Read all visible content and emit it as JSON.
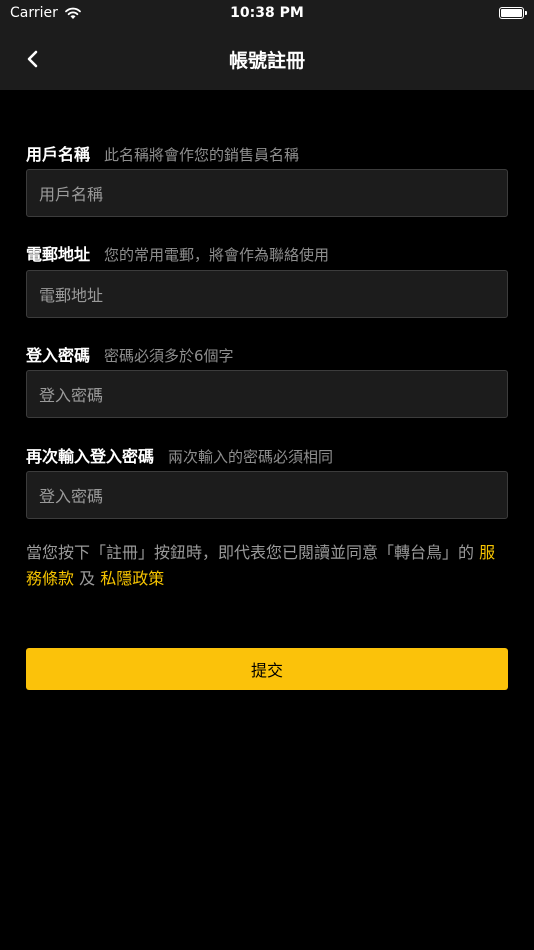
{
  "status_bar": {
    "carrier": "Carrier",
    "time": "10:38 PM",
    "battery_level": 1.0
  },
  "nav": {
    "title": "帳號註冊",
    "back_icon": "chevron-left-icon"
  },
  "fields": {
    "username": {
      "label": "用戶名稱",
      "hint": "此名稱將會作您的銷售員名稱",
      "placeholder": "用戶名稱"
    },
    "email": {
      "label": "電郵地址",
      "hint": "您的常用電郵，將會作為聯絡使用",
      "placeholder": "電郵地址"
    },
    "password": {
      "label": "登入密碼",
      "hint": "密碼必須多於6個字",
      "placeholder": "登入密碼"
    },
    "confirm_password": {
      "label": "再次輸入登入密碼",
      "hint": "兩次輸入的密碼必須相同",
      "placeholder": "登入密碼"
    }
  },
  "agreement": {
    "text_before": "當您按下「註冊」按鈕時，即代表您已閱讀並同意「轉台鳥」的 ",
    "terms_link": "服務條款",
    "conjunction": " 及 ",
    "privacy_link": "私隱政策"
  },
  "submit": {
    "label": "提交"
  },
  "colors": {
    "accent": "#fbc20a",
    "link": "#f6c400",
    "background": "#000000",
    "surface": "#1c1c1c"
  }
}
